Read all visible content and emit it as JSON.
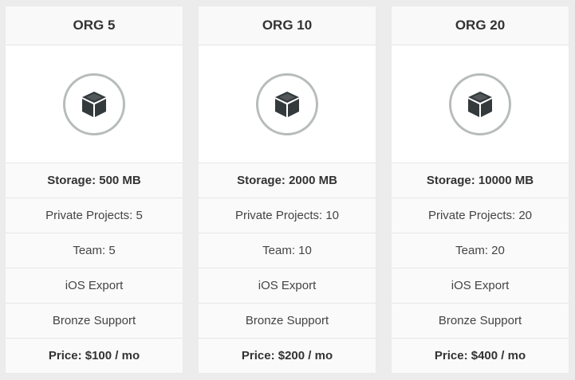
{
  "plans": [
    {
      "name": "ORG 5",
      "icon": "box-icon",
      "storage": "Storage: 500 MB",
      "projects": "Private Projects: 5",
      "team": "Team: 5",
      "export": "iOS Export",
      "support": "Bronze Support",
      "price": "Price: $100 / mo"
    },
    {
      "name": "ORG 10",
      "icon": "box-icon",
      "storage": "Storage: 2000 MB",
      "projects": "Private Projects: 10",
      "team": "Team: 10",
      "export": "iOS Export",
      "support": "Bronze Support",
      "price": "Price: $200 / mo"
    },
    {
      "name": "ORG 20",
      "icon": "box-icon",
      "storage": "Storage: 10000 MB",
      "projects": "Private Projects: 20",
      "team": "Team: 20",
      "export": "iOS Export",
      "support": "Bronze Support",
      "price": "Price: $400 / mo"
    }
  ],
  "colors": {
    "background": "#ececec",
    "card": "#fafafa",
    "icon_ring": "#b7bcbb",
    "icon": "#343a3c",
    "text": "#333333"
  }
}
